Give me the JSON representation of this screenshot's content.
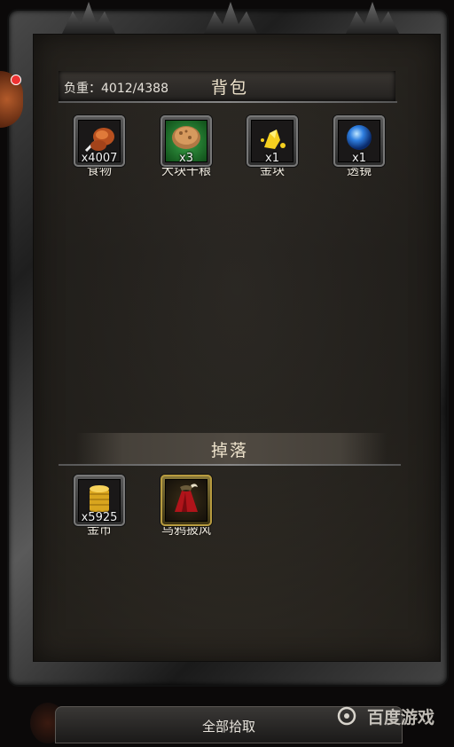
{
  "backpack": {
    "weight_label": "负重：4012/4388",
    "title": "背包",
    "items": [
      {
        "name": "食物",
        "qty": "x4007",
        "icon": "roast-meat-icon"
      },
      {
        "name": "大块干粮",
        "qty": "x3",
        "icon": "bread-icon"
      },
      {
        "name": "金块",
        "qty": "x1",
        "icon": "gold-nugget-icon"
      },
      {
        "name": "透镜",
        "qty": "x1",
        "icon": "blue-orb-icon"
      }
    ]
  },
  "drops": {
    "title": "掉落",
    "items": [
      {
        "name": "金币",
        "qty": "x5925",
        "icon": "gold-coins-icon"
      },
      {
        "name": "乌鸦披风",
        "qty": "",
        "icon": "red-cloak-icon"
      }
    ]
  },
  "footer": {
    "pickup_all_label": "全部拾取",
    "watermark": "百度游戏"
  }
}
